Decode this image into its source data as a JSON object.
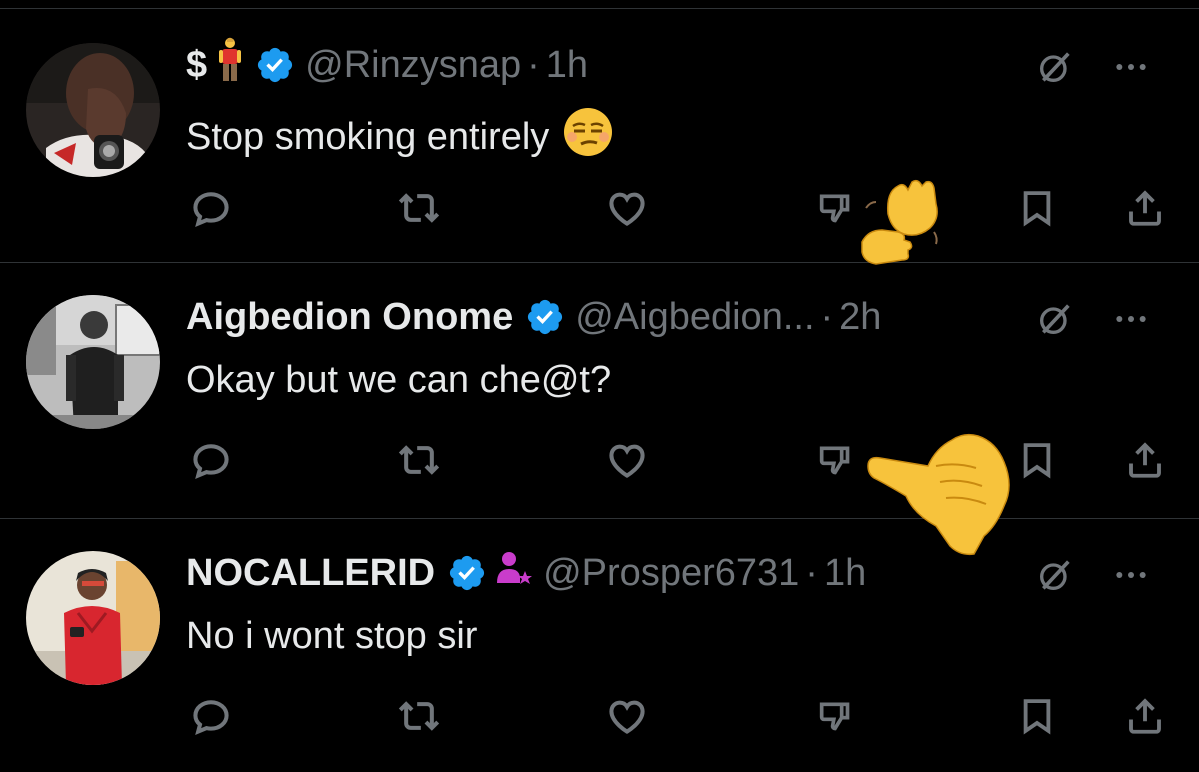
{
  "tweets": [
    {
      "name": "$",
      "name_emoji": "standing-man-emoji",
      "handle": "@Rinzysnap",
      "separator": "·",
      "time": "1h",
      "text": "Stop smoking entirely",
      "text_emoji": "unamused-face-emoji",
      "verified": true
    },
    {
      "name": "Aigbedion Onome",
      "handle": "@Aigbedion...",
      "separator": "·",
      "time": "2h",
      "text": "Okay but we can che@t?",
      "verified": true
    },
    {
      "name": "NOCALLERID",
      "name_badge": "person-star-icon",
      "handle": "@Prosper6731",
      "separator": "·",
      "time": "1h",
      "text": "No i wont stop sir",
      "verified": true
    }
  ],
  "overlays": [
    "waving-hands-emoji",
    "thumb-pointing-hand-emoji"
  ],
  "colors": {
    "background": "#000000",
    "text": "#e7e9ea",
    "muted": "#71767b",
    "verified": "#1d9bf0",
    "divider": "#2f3336",
    "badge": "#c93ccb"
  },
  "action_icons": [
    "reply-icon",
    "retweet-icon",
    "like-icon",
    "dislike-icon",
    "bookmark-icon",
    "share-icon"
  ],
  "top_icons": [
    "grok-icon",
    "more-icon"
  ]
}
